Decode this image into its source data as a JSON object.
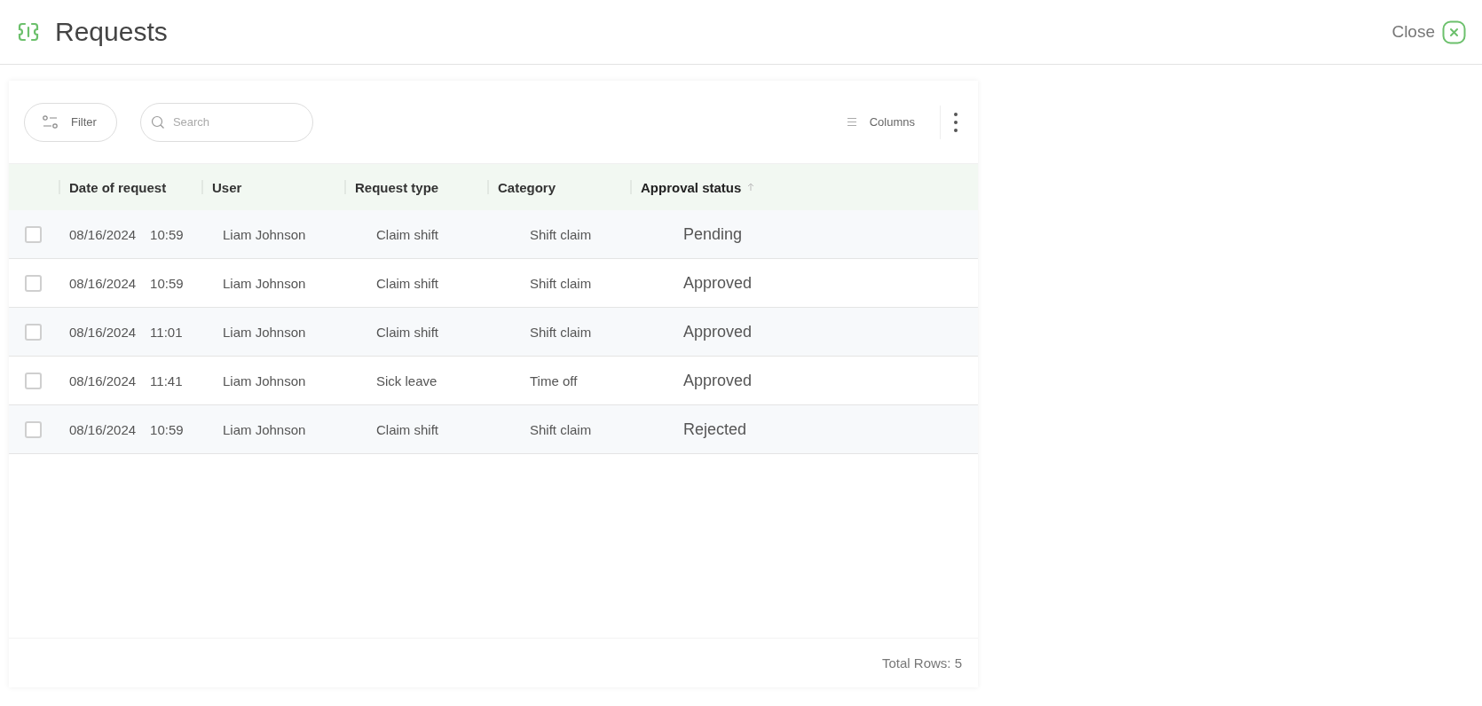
{
  "header": {
    "title": "Requests",
    "close_label": "Close"
  },
  "toolbar": {
    "filter_label": "Filter",
    "search": {
      "placeholder": "Search"
    },
    "columns_label": "Columns"
  },
  "table": {
    "columns": [
      {
        "label": "Date of request",
        "sorted": false
      },
      {
        "label": "User",
        "sorted": false
      },
      {
        "label": "Request type",
        "sorted": false
      },
      {
        "label": "Category",
        "sorted": false
      },
      {
        "label": "Approval status",
        "sorted": true
      }
    ],
    "rows": [
      {
        "checked": false,
        "date": "08/16/2024",
        "time": "10:59",
        "user": "Liam Johnson",
        "request_type": "Claim shift",
        "category": "Shift claim",
        "status": "Pending"
      },
      {
        "checked": false,
        "date": "08/16/2024",
        "time": "10:59",
        "user": "Liam Johnson",
        "request_type": "Claim shift",
        "category": "Shift claim",
        "status": "Approved"
      },
      {
        "checked": false,
        "date": "08/16/2024",
        "time": "11:01",
        "user": "Liam Johnson",
        "request_type": "Claim shift",
        "category": "Shift claim",
        "status": "Approved"
      },
      {
        "checked": false,
        "date": "08/16/2024",
        "time": "11:41",
        "user": "Liam Johnson",
        "request_type": "Sick leave",
        "category": "Time off",
        "status": "Approved"
      },
      {
        "checked": false,
        "date": "08/16/2024",
        "time": "10:59",
        "user": "Liam Johnson",
        "request_type": "Claim shift",
        "category": "Shift claim",
        "status": "Rejected"
      }
    ]
  },
  "footer": {
    "total": "Total Rows: 5"
  }
}
